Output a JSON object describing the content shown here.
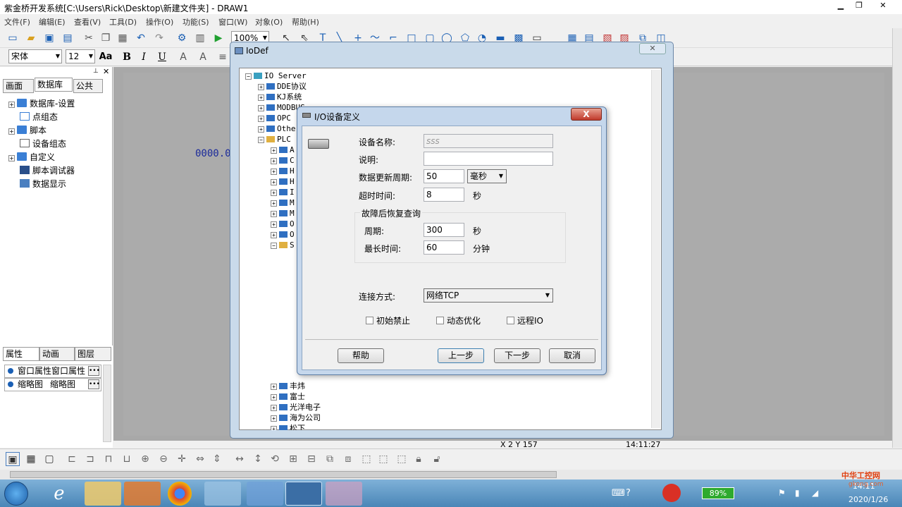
{
  "window": {
    "title": "紫金桥开发系统[C:\\Users\\Rick\\Desktop\\新建文件夹] - DRAW1",
    "min": "▁",
    "max": "❐",
    "close": "✕"
  },
  "menu": [
    "文件(F)",
    "编辑(E)",
    "查看(V)",
    "工具(D)",
    "操作(O)",
    "功能(S)",
    "窗口(W)",
    "对象(O)",
    "帮助(H)"
  ],
  "toolbar": {
    "zoom": "100%",
    "font": "宋体",
    "size": "12",
    "aa": "Aa",
    "bold": "B",
    "italic": "I",
    "underline": "U"
  },
  "left_tabs": [
    "画面",
    "数据库",
    "公共"
  ],
  "left_tree": [
    "数据库-设置",
    "点组态",
    "脚本",
    "设备组态",
    "自定义",
    "脚本调试器",
    "数据显示"
  ],
  "canvas_text": "0000.0",
  "status": {
    "coords": "X 2 Y 157",
    "time": "14:11:27"
  },
  "prop_tabs": [
    "属性",
    "动画",
    "图层"
  ],
  "prop_rows": [
    {
      "name": "窗口属性",
      "value": "窗口属性"
    },
    {
      "name": "缩略图",
      "value": "缩略图"
    }
  ],
  "iodef": {
    "title": "IoDef",
    "close": "✕",
    "root": "IO Server",
    "items": [
      "DDE协议",
      "KJ系统",
      "MODBUS",
      "OPC",
      "Other",
      "PLC"
    ],
    "plc_children": [
      "A",
      "C",
      "H",
      "H",
      "I",
      "M",
      "M",
      "O",
      "O",
      "S"
    ],
    "bottom_items": [
      "丰炜",
      "富士",
      "光洋电子",
      "海为公司",
      "松下"
    ]
  },
  "dialog": {
    "title": "I/O设备定义",
    "close": "X",
    "device_name_label": "设备名称:",
    "device_name_value": "sss",
    "desc_label": "说明:",
    "desc_value": "",
    "update_label": "数据更新周期:",
    "update_value": "50",
    "update_unit": "毫秒",
    "timeout_label": "超时时间:",
    "timeout_value": "8",
    "timeout_unit": "秒",
    "recovery_group": "故障后恢复查询",
    "period_label": "周期:",
    "period_value": "300",
    "period_unit": "秒",
    "maxtime_label": "最长时间:",
    "maxtime_value": "60",
    "maxtime_unit": "分钟",
    "conn_label": "连接方式:",
    "conn_value": "网络TCP",
    "chk_init": "初始禁止",
    "chk_opt": "动态优化",
    "chk_remote": "远程IO",
    "btn_help": "帮助",
    "btn_prev": "上一步",
    "btn_next": "下一步",
    "btn_cancel": "取消"
  },
  "taskbar": {
    "battery": "89%",
    "time": "14:11",
    "date": "2020/1/26",
    "watermark": "中华工控网",
    "watermark_url": "gkong.com"
  }
}
